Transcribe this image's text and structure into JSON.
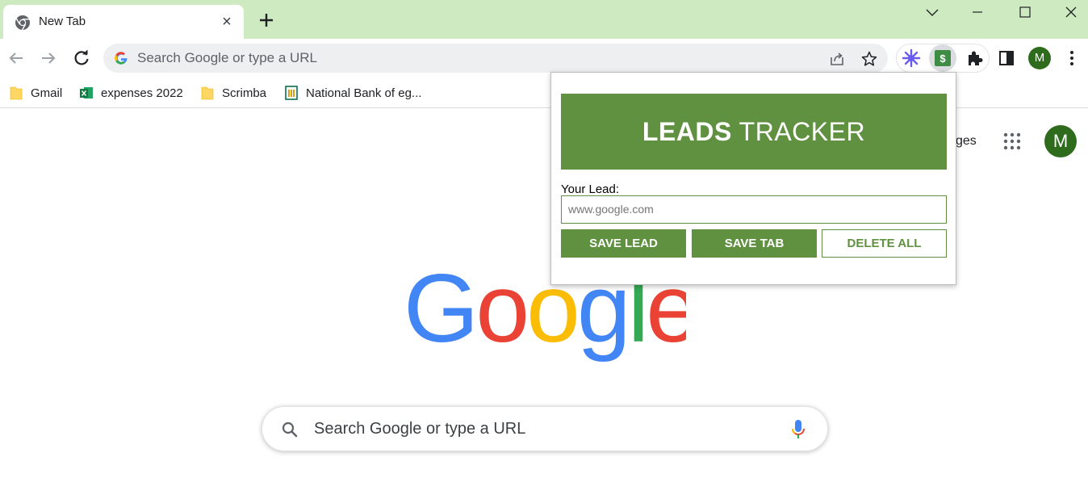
{
  "tab": {
    "title": "New Tab"
  },
  "omnibox": {
    "placeholder": "Search Google or type a URL"
  },
  "bookmarks": [
    {
      "label": "Gmail",
      "icon": "folder-icon"
    },
    {
      "label": "expenses 2022",
      "icon": "excel-icon"
    },
    {
      "label": "Scrimba",
      "icon": "folder-icon"
    },
    {
      "label": "National Bank of eg...",
      "icon": "bank-icon"
    }
  ],
  "profile": {
    "initial": "M"
  },
  "google_page": {
    "images_link": "ges",
    "avatar_initial": "M",
    "logo_text": "Google",
    "search_placeholder": "Search Google or type a URL"
  },
  "popup": {
    "title_bold": "LEADS",
    "title_light": "TRACKER",
    "lead_label": "Your Lead:",
    "lead_placeholder": "www.google.com",
    "save_lead": "SAVE LEAD",
    "save_tab": "SAVE TAB",
    "delete_all": "DELETE ALL"
  },
  "colors": {
    "frame": "#cdeac0",
    "accent": "#5f9141",
    "profile": "#2e6b1d"
  }
}
